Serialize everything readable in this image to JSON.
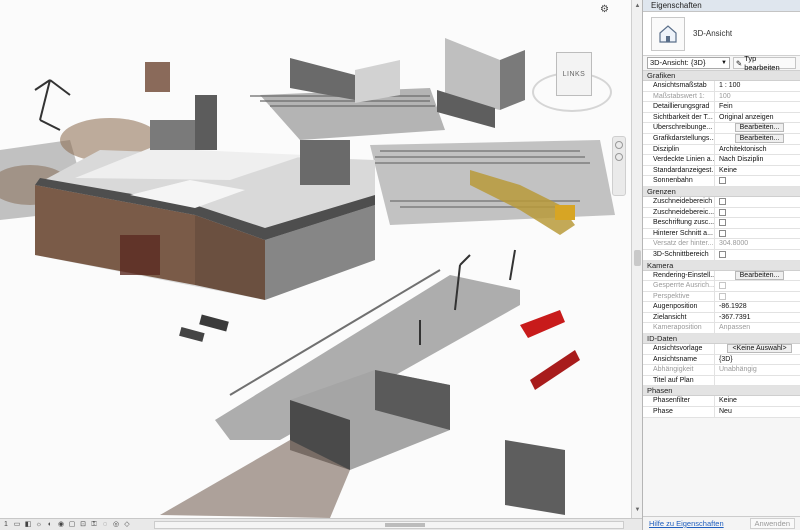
{
  "viewport": {
    "viewcube_label": "LINKS"
  },
  "properties": {
    "title": "Eigenschaften",
    "type_label": "3D-Ansicht",
    "view_selector": "3D-Ansicht: {3D}",
    "edit_type_label": "Typ bearbeiten",
    "sections": {
      "grafiken": "Grafiken",
      "grenzen": "Grenzen",
      "kamera": "Kamera",
      "id_daten": "ID-Daten",
      "phasen": "Phasen"
    },
    "grafiken": [
      {
        "key": "Ansichtsmaßstab",
        "value": "1 : 100"
      },
      {
        "key": "Maßstabswert 1:",
        "value": "100"
      },
      {
        "key": "Detaillierungsgrad",
        "value": "Fein"
      },
      {
        "key": "Sichtbarkeit der T...",
        "value": "Original anzeigen"
      },
      {
        "key": "Überschreibunge...",
        "value": "Bearbeiten..."
      },
      {
        "key": "Grafikdarstellungs...",
        "value": "Bearbeiten..."
      },
      {
        "key": "Disziplin",
        "value": "Architektonisch"
      },
      {
        "key": "Verdeckte Linien a...",
        "value": "Nach Disziplin"
      },
      {
        "key": "Standardanzeigest...",
        "value": "Keine"
      },
      {
        "key": "Sonnenbahn",
        "value": ""
      }
    ],
    "grenzen": [
      {
        "key": "Zuschneidebereich",
        "value": ""
      },
      {
        "key": "Zuschneidebereic...",
        "value": ""
      },
      {
        "key": "Beschriftung zusc...",
        "value": ""
      },
      {
        "key": "Hinterer Schnitt a...",
        "value": ""
      },
      {
        "key": "Versatz der hinter...",
        "value": "304.8000"
      },
      {
        "key": "3D-Schnittbereich",
        "value": ""
      }
    ],
    "kamera": [
      {
        "key": "Rendering-Einstell...",
        "value": "Bearbeiten..."
      },
      {
        "key": "Gesperrte Ausrich...",
        "value": ""
      },
      {
        "key": "Perspektive",
        "value": ""
      },
      {
        "key": "Augenposition",
        "value": "-86.1928"
      },
      {
        "key": "Zielansicht",
        "value": "-367.7391"
      },
      {
        "key": "Kameraposition",
        "value": "Anpassen"
      }
    ],
    "id_daten": [
      {
        "key": "Ansichtsvorlage",
        "value": "<Keine Auswahl>"
      },
      {
        "key": "Ansichtsname",
        "value": "{3D}"
      },
      {
        "key": "Abhängigkeit",
        "value": "Unabhängig"
      },
      {
        "key": "Titel auf Plan",
        "value": ""
      }
    ],
    "phasen": [
      {
        "key": "Phasenfilter",
        "value": "Keine"
      },
      {
        "key": "Phase",
        "value": "Neu"
      }
    ],
    "help_link": "Hilfe zu Eigenschaften",
    "apply_label": "Anwenden"
  }
}
